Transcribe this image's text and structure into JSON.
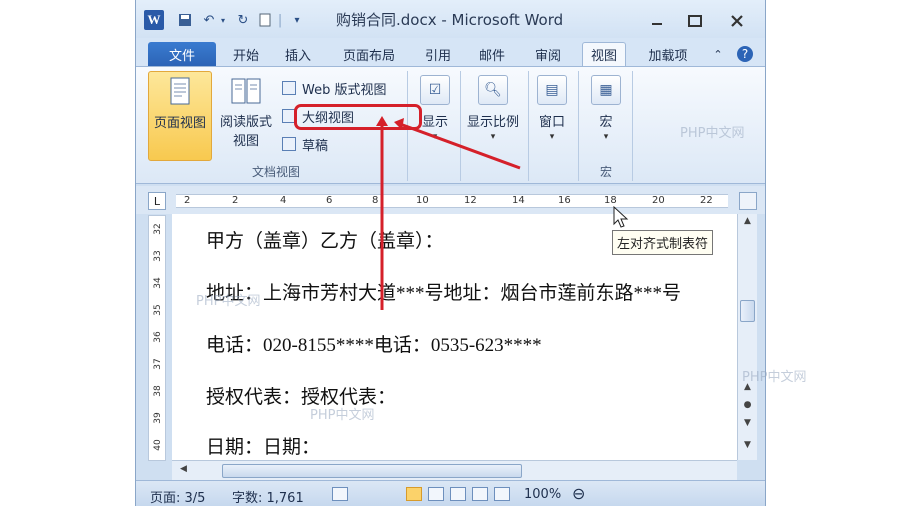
{
  "window": {
    "title": "购销合同.docx - Microsoft Word",
    "logo": "W"
  },
  "quick_access": [
    "save-icon",
    "undo-icon",
    "redo-icon",
    "new-icon"
  ],
  "window_controls": {
    "minimize": "▭",
    "maximize": "▢",
    "close": "✕"
  },
  "tabs": [
    {
      "label": "文件"
    },
    {
      "label": "开始"
    },
    {
      "label": "插入"
    },
    {
      "label": "页面布局"
    },
    {
      "label": "引用"
    },
    {
      "label": "邮件"
    },
    {
      "label": "审阅"
    },
    {
      "label": "视图"
    },
    {
      "label": "加载项"
    }
  ],
  "ribbon": {
    "page_view": "页面视图",
    "reading_view_line1": "阅读版式",
    "reading_view_line2": "视图",
    "web_view": "Web 版式视图",
    "outline_view": "大纲视图",
    "draft": "草稿",
    "doc_views_group": "文档视图",
    "show": "显示",
    "zoom": "显示比例",
    "window": "窗口",
    "macro": "宏",
    "macro_group": "宏"
  },
  "ruler_labels": [
    "2",
    "2",
    "4",
    "6",
    "8",
    "10",
    "12",
    "14",
    "16",
    "18",
    "20",
    "22"
  ],
  "vruler_labels": [
    "32",
    "33",
    "34",
    "35",
    "36",
    "37",
    "38",
    "39",
    "40"
  ],
  "document": {
    "lines": [
      "甲方（盖章）乙方（盖章）：",
      "地址：上海市芳村大道***号地址：烟台市莲前东路***号",
      "电话：020-8155****电话：0535-623****",
      "授权代表：授权代表：",
      "日期：日期："
    ]
  },
  "tooltip": "左对齐式制表符",
  "status": {
    "page": "页面: 3/5",
    "words": "字数: 1,761",
    "zoom": "100%"
  },
  "watermark": "PHP中文网",
  "colors": {
    "accent": "#2c64b6",
    "highlight": "#f8c94f",
    "annotation": "#d5202a"
  }
}
